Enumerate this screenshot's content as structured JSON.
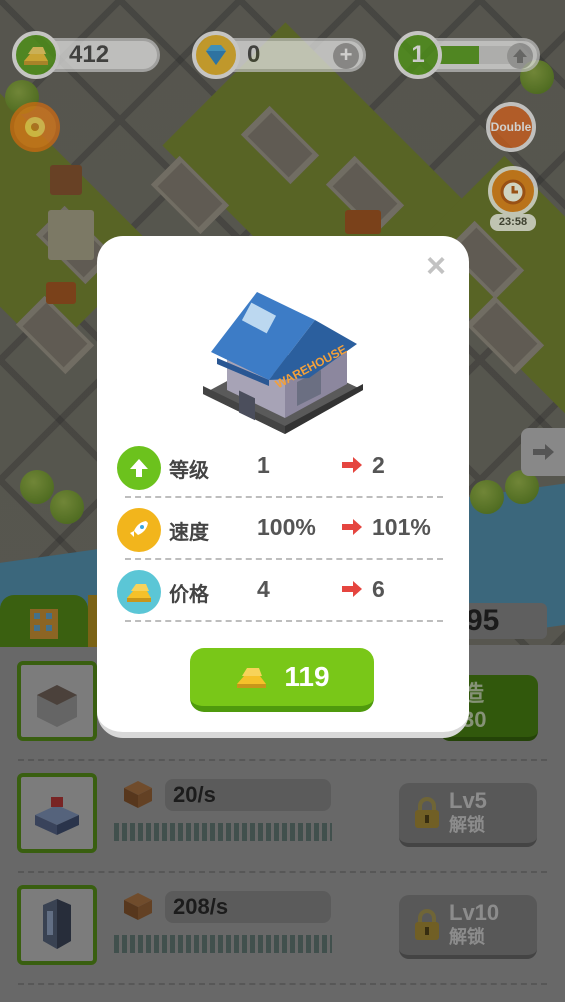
{
  "hud": {
    "gold": "412",
    "gems": "0",
    "level": "1",
    "gem_plus": "+",
    "double_label": "Double",
    "timer": "23:58",
    "level_progress": 0.55
  },
  "modal": {
    "building_sign": "WAREHOUSE",
    "stats": [
      {
        "label": "等级",
        "current": "1",
        "next": "2",
        "icon": "level-up-arrow-icon",
        "color": "#6cc21d"
      },
      {
        "label": "速度",
        "current": "100%",
        "next": "101%",
        "icon": "rocket-icon",
        "color": "#f2b51c"
      },
      {
        "label": "价格",
        "current": "4",
        "next": "6",
        "icon": "gold-bars-icon",
        "color": "#5bc6d6"
      }
    ],
    "buy_cost": "119",
    "close": "×"
  },
  "bottom": {
    "partial_counter": "95",
    "build_button": {
      "line1": "造",
      "line2": "30"
    },
    "rows": [
      {
        "rate": "20/s",
        "lock_level": "Lv5",
        "lock_text": "解锁"
      },
      {
        "rate": "208/s",
        "lock_level": "Lv10",
        "lock_text": "解锁"
      }
    ]
  },
  "colors": {
    "accent_green": "#79c718",
    "arrow_red": "#e5453f",
    "gold": "#f5c12a"
  }
}
